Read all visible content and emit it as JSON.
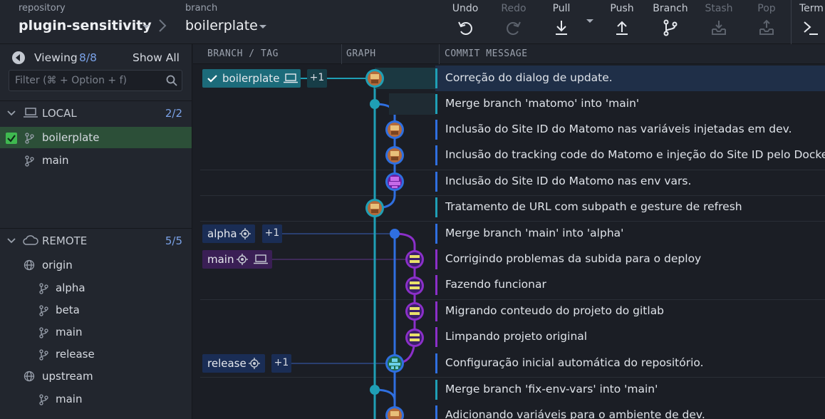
{
  "toolbar": {
    "repository_label": "repository",
    "repository_name": "plugin-sensitivity",
    "branch_label": "branch",
    "branch_name": "boilerplate",
    "actions": {
      "undo": "Undo",
      "redo": "Redo",
      "pull": "Pull",
      "push": "Push",
      "branch": "Branch",
      "stash": "Stash",
      "pop": "Pop",
      "terminal": "Term"
    }
  },
  "sidebar": {
    "viewing_label": "Viewing",
    "viewing_count": "8/8",
    "show_all": "Show All",
    "filter_placeholder": "Filter (⌘ + Option + f)",
    "local": {
      "title": "LOCAL",
      "count": "2/2",
      "branches": [
        "boilerplate",
        "main"
      ]
    },
    "remote": {
      "title": "REMOTE",
      "count": "5/5",
      "remotes": [
        {
          "name": "origin",
          "branches": [
            "alpha",
            "beta",
            "main",
            "release"
          ]
        },
        {
          "name": "upstream",
          "branches": [
            "main"
          ]
        }
      ]
    }
  },
  "columns": {
    "branch_tag": "BRANCH / TAG",
    "graph": "GRAPH",
    "commit_message": "COMMIT MESSAGE"
  },
  "refs": {
    "boilerplate": {
      "label": "boilerplate",
      "extra": "+1"
    },
    "alpha": {
      "label": "alpha",
      "extra": "+1"
    },
    "main": {
      "label": "main"
    },
    "release": {
      "label": "release",
      "extra": "+1"
    }
  },
  "commits": [
    "Correção do dialog de update.",
    "Merge branch 'matomo' into 'main'",
    "Inclusão do Site ID do Matomo nas variáveis injetadas em dev.",
    "Inclusão do tracking code do Matomo e injeção do Site ID pelo Docker.",
    "Inclusão do Site ID do Matomo nas env vars.",
    "Tratamento de URL com subpath e gesture de refresh",
    "Merge branch 'main' into 'alpha'",
    "Corrigindo problemas da subida para o deploy",
    "Fazendo funcionar",
    "Migrando conteudo do projeto do gitlab",
    "Limpando projeto original",
    "Configuração inicial automática do repositório.",
    "Merge branch 'fix-env-vars' into 'main'",
    "Adicionando variáveis para o ambiente de dev."
  ],
  "colors": {
    "teal": "#1f9fb5",
    "blue": "#2f6fe0",
    "purple": "#8b2fc9",
    "local_active": "#2c4f38",
    "selected_row": "#1f2f48"
  }
}
